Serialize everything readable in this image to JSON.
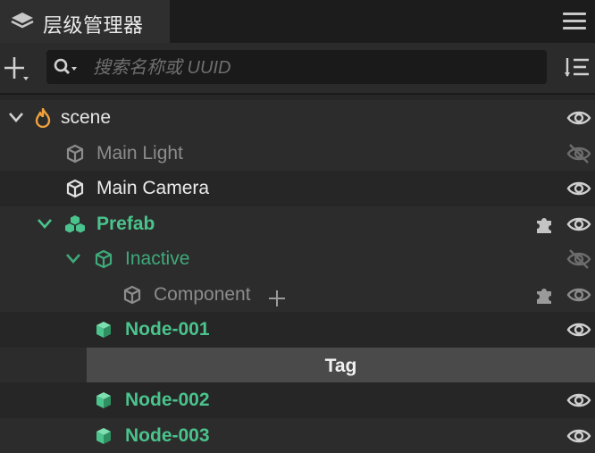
{
  "panel": {
    "title": "层级管理器",
    "icons": {
      "tab": "layers-icon",
      "menu": "hamburger-menu-icon"
    }
  },
  "toolbar": {
    "add_icon": "plus-icon",
    "search_placeholder": "搜索名称或 UUID",
    "search_value": "",
    "search_icon": "search-icon",
    "sort_icon": "sort-list-icon"
  },
  "tree": {
    "scene": {
      "label": "scene",
      "icon": "flame-icon",
      "expanded": true,
      "visible": true
    },
    "main_light": {
      "label": "Main Light",
      "icon": "cube-icon",
      "active": false,
      "visible": false
    },
    "main_camera": {
      "label": "Main Camera",
      "icon": "cube-icon",
      "active": true,
      "visible": true
    },
    "prefab": {
      "label": "Prefab",
      "icon": "prefab-cubes-icon",
      "expanded": true,
      "visible": true,
      "badge": "puzzle-icon"
    },
    "inactive": {
      "label": "Inactive",
      "icon": "prefab-cube-icon",
      "expanded": true,
      "visible": false
    },
    "component": {
      "label": "Component",
      "icon": "cube-icon",
      "visible": true,
      "badge": "puzzle-icon"
    },
    "node_001": {
      "label": "Node-001",
      "icon": "prefab-cube-icon",
      "visible": true
    },
    "tag": {
      "label": "Tag"
    },
    "node_002": {
      "label": "Node-002",
      "icon": "prefab-cube-icon",
      "visible": true
    },
    "node_003": {
      "label": "Node-003",
      "icon": "prefab-cube-icon",
      "visible": true
    }
  },
  "colors": {
    "prefab_green": "#4ac38c",
    "scene_orange": "#f0a23c",
    "background": "#262626",
    "selection": "#4a4a4a"
  }
}
